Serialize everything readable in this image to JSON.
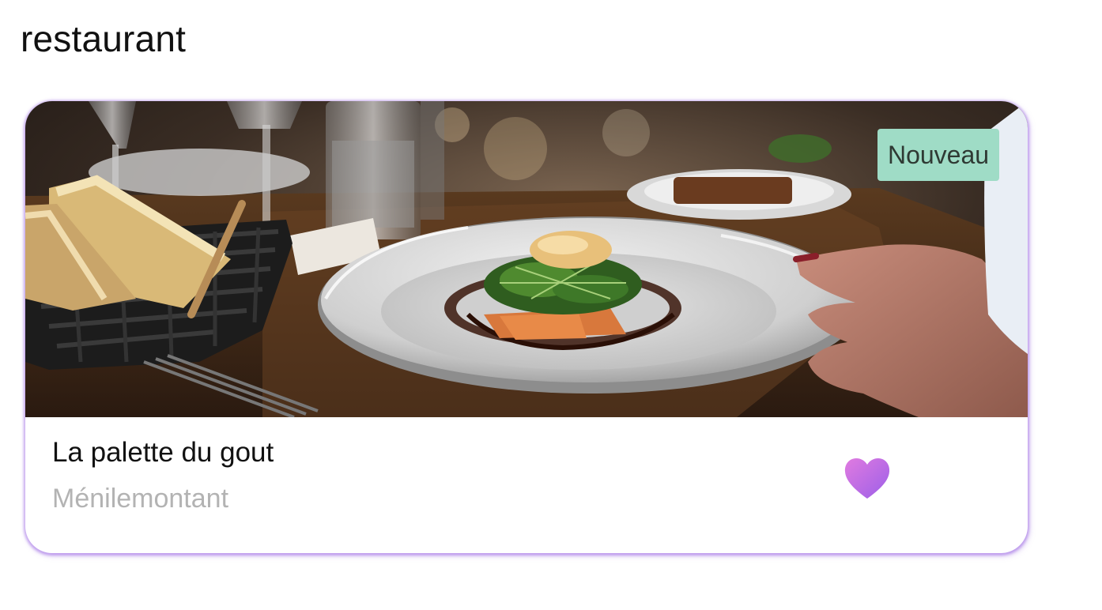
{
  "page": {
    "title": "restaurant"
  },
  "card": {
    "badge": "Nouveau",
    "name": "La palette du gout",
    "neighborhood": "Ménilemontant",
    "favorite_icon": "heart-icon",
    "photo_alt": "plated dish on a restaurant table"
  },
  "colors": {
    "card_glow": "#a46ee6",
    "badge_bg": "#9fdcc6",
    "heart_start": "#e07be0",
    "heart_end": "#9c5fe8",
    "subtitle": "#b3b3b3"
  }
}
